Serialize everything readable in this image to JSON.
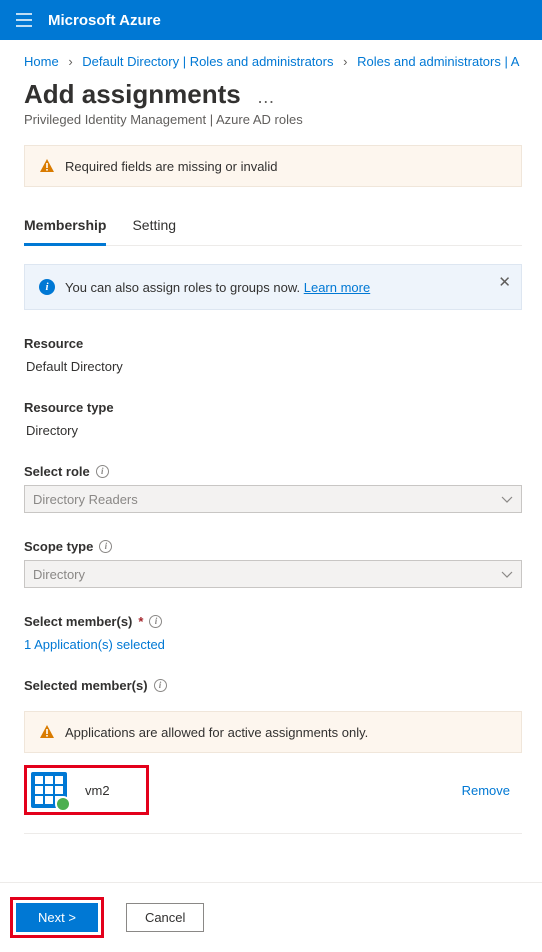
{
  "header": {
    "brand": "Microsoft Azure"
  },
  "breadcrumb": {
    "home": "Home",
    "dir": "Default Directory | Roles and administrators",
    "roles": "Roles and administrators | A"
  },
  "page": {
    "title": "Add assignments",
    "ellipsis": "…",
    "subtitle": "Privileged Identity Management | Azure AD roles"
  },
  "banner_warning": "Required fields are missing or invalid",
  "tabs": {
    "membership": "Membership",
    "setting": "Setting"
  },
  "info": {
    "text": "You can also assign roles to groups now. ",
    "link": "Learn more"
  },
  "fields": {
    "resource_label": "Resource",
    "resource_value": "Default Directory",
    "resource_type_label": "Resource type",
    "resource_type_value": "Directory",
    "select_role_label": "Select role",
    "select_role_value": "Directory Readers",
    "scope_type_label": "Scope type",
    "scope_type_value": "Directory",
    "select_members_label": "Select member(s)",
    "select_members_link": "1 Application(s) selected",
    "selected_members_label": "Selected member(s)"
  },
  "member_warning": "Applications are allowed for active assignments only.",
  "members": [
    {
      "name": "vm2",
      "remove": "Remove"
    }
  ],
  "buttons": {
    "next": "Next >",
    "cancel": "Cancel"
  }
}
